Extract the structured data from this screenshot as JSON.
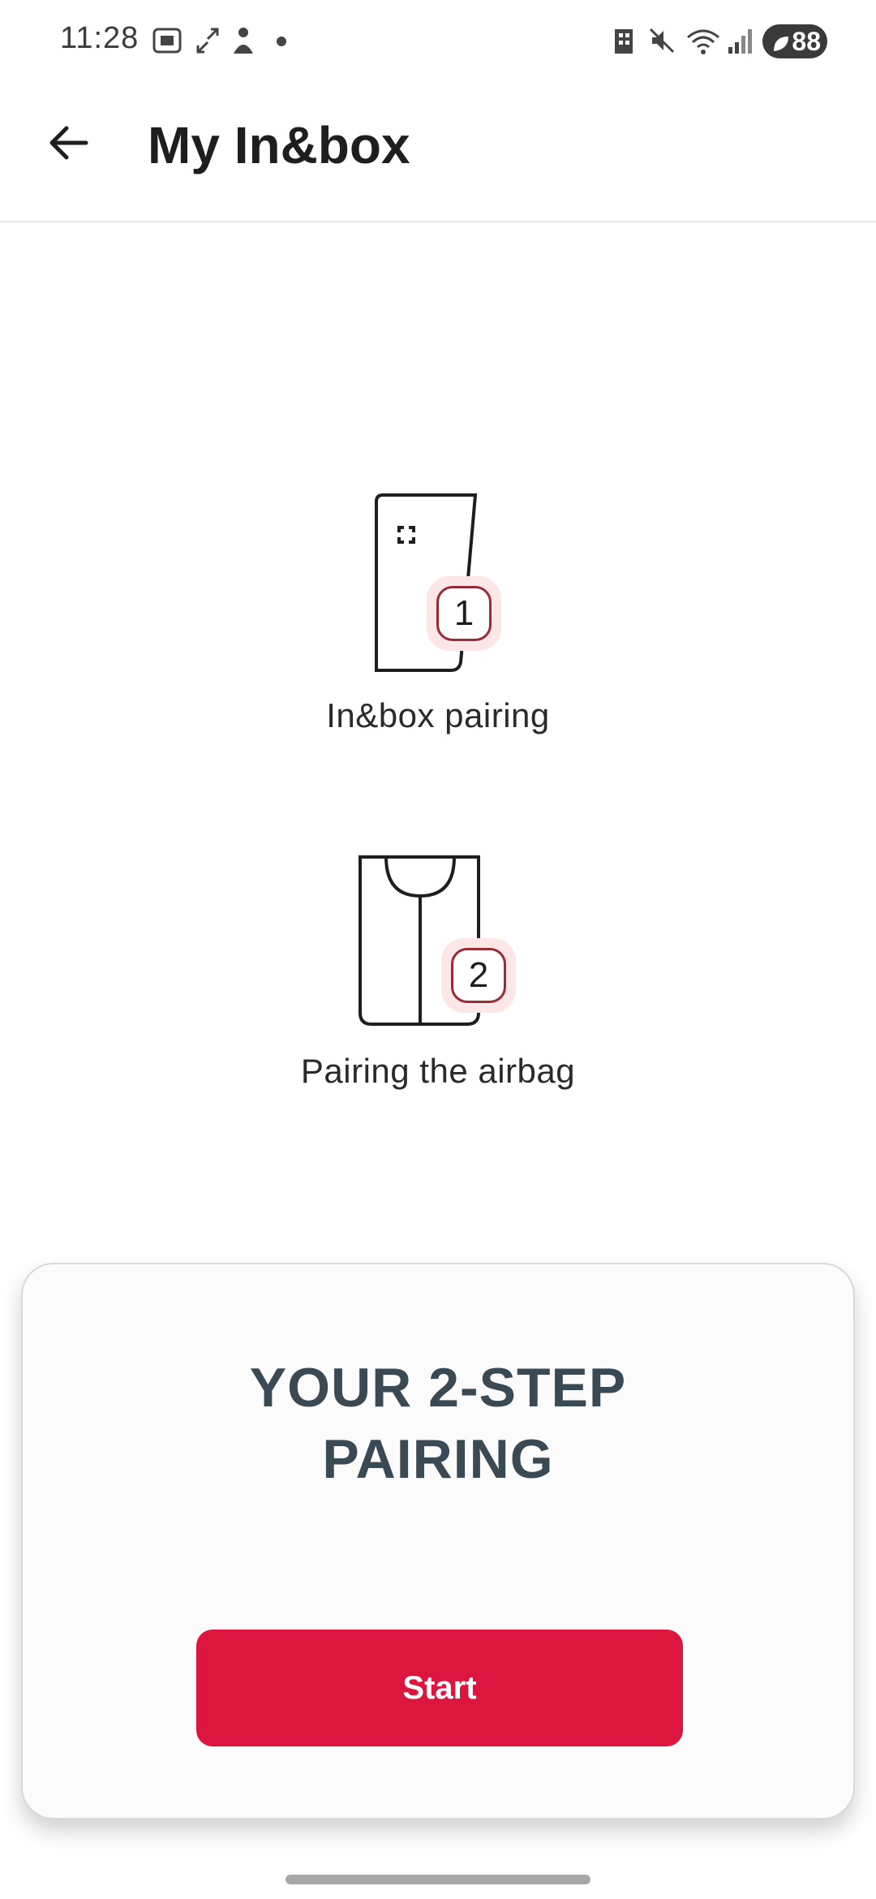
{
  "status_bar": {
    "time": "11:28",
    "battery": "88"
  },
  "header": {
    "title": "My In&box"
  },
  "steps": [
    {
      "number": "1",
      "label": "In&box pairing",
      "icon": "inbox-device-icon"
    },
    {
      "number": "2",
      "label": "Pairing the airbag",
      "icon": "airbag-vest-icon"
    }
  ],
  "card": {
    "title_line1": "YOUR 2-STEP",
    "title_line2": "PAIRING",
    "start_label": "Start"
  },
  "colors": {
    "accent": "#dc163f",
    "badge_bg": "#fde6e6",
    "badge_border": "#9b2a34",
    "card_title": "#3a4a54"
  }
}
